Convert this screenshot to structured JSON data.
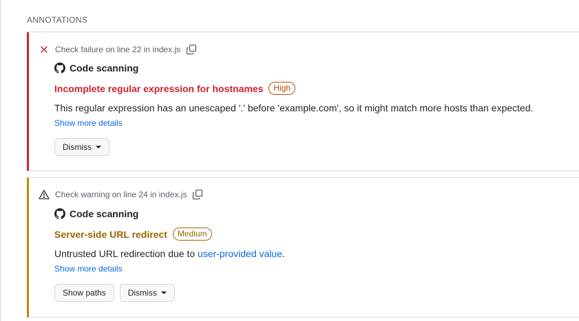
{
  "section": {
    "title": "ANNOTATIONS"
  },
  "annotations": [
    {
      "status": "failure",
      "status_icon": "x-icon",
      "check_text": "Check failure on line 22 in index.js",
      "tool": "Code scanning",
      "rule": "Incomplete regular expression for hostnames",
      "severity": "High",
      "message": "This regular expression has an unescaped '.' before 'example.com', so it might match more hosts than expected.",
      "more": "Show more details",
      "buttons": {
        "dismiss": "Dismiss"
      }
    },
    {
      "status": "warning",
      "status_icon": "alert-triangle-icon",
      "check_text": "Check warning on line 24 in index.js",
      "tool": "Code scanning",
      "rule": "Server-side URL redirect",
      "severity": "Medium",
      "message_prefix": "Untrusted URL redirection due to ",
      "message_link": "user-provided value",
      "message_suffix": ".",
      "more": "Show more details",
      "buttons": {
        "paths": "Show paths",
        "dismiss": "Dismiss"
      }
    }
  ],
  "colors": {
    "failure": "#cf222e",
    "warning": "#bf8700",
    "link": "#0969da"
  }
}
